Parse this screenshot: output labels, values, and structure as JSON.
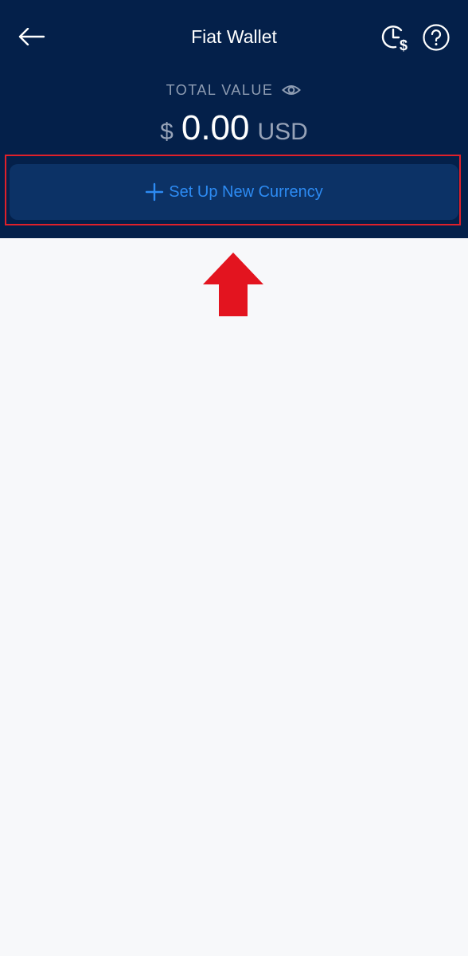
{
  "header": {
    "title": "Fiat Wallet",
    "back_icon": "arrow-left-icon",
    "history_icon": "clock-dollar-icon",
    "help_icon": "question-circle-icon"
  },
  "summary": {
    "label": "TOTAL VALUE",
    "visibility_icon": "eye-icon",
    "currency_symbol": "$",
    "amount": "0.00",
    "currency_code": "USD"
  },
  "actions": {
    "setup_label": "Set Up New Currency",
    "setup_icon": "plus-icon"
  },
  "annotation": {
    "highlight_color": "#e0202a",
    "arrow_icon": "red-up-arrow-icon"
  },
  "colors": {
    "header_bg": "#04204a",
    "button_bg": "#0c3266",
    "accent": "#2d8bf3",
    "page_bg": "#f7f8fa"
  }
}
